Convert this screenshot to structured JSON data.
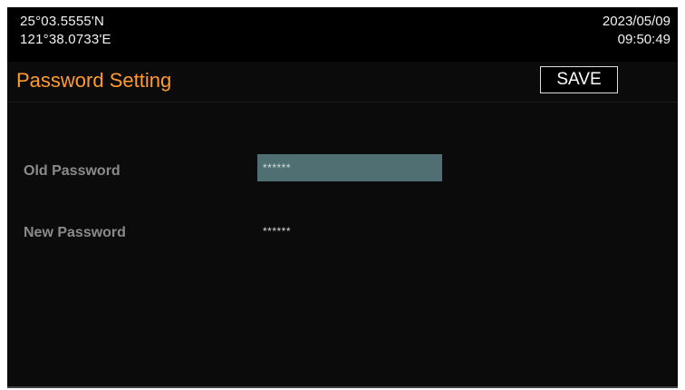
{
  "status": {
    "latitude": "25°03.5555'N",
    "longitude": "121°38.0733'E",
    "date": "2023/05/09",
    "time": "09:50:49"
  },
  "header": {
    "title": "Password Setting",
    "save_label": "SAVE"
  },
  "form": {
    "old_password": {
      "label": "Old Password",
      "value": "******"
    },
    "new_password": {
      "label": "New Password",
      "value": "******"
    }
  },
  "colors": {
    "title": "#ff9a2e",
    "selected_field": "#4f6f73",
    "label": "#8a8a8a",
    "background": "#0b0b0b"
  }
}
